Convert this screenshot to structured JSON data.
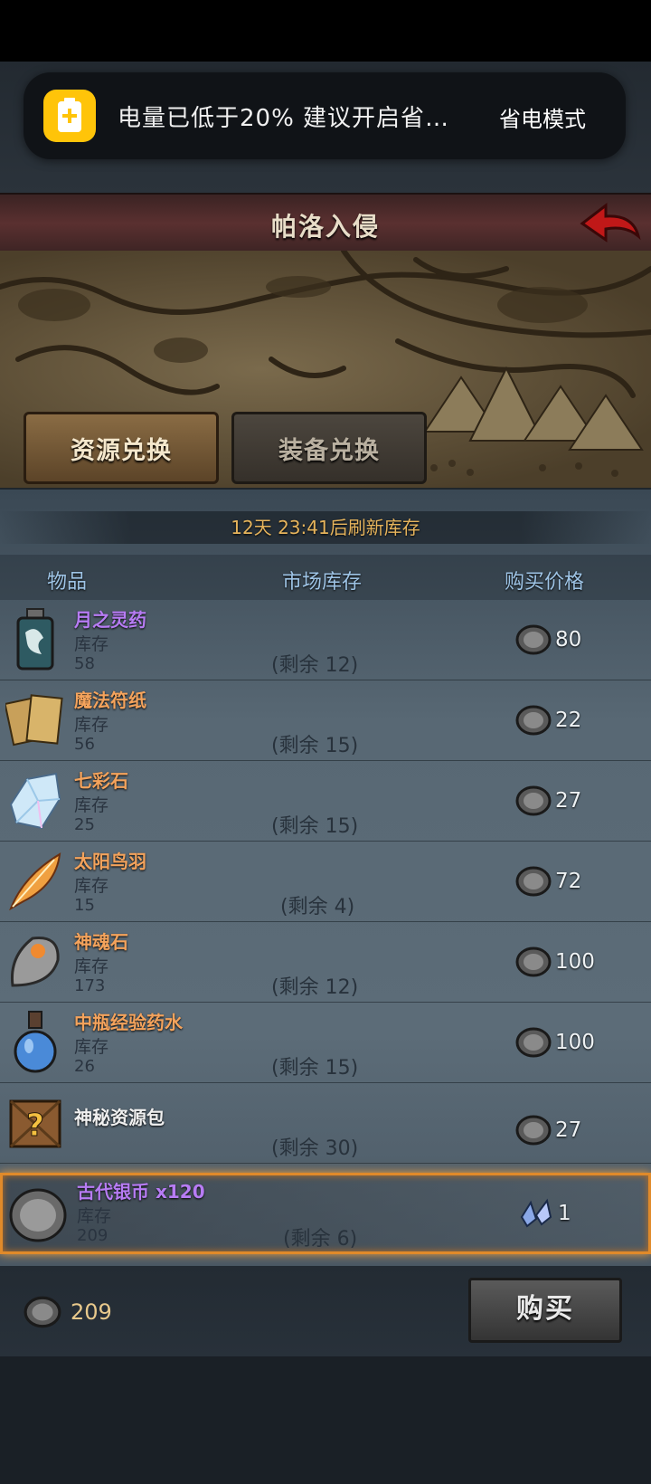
{
  "notification": {
    "icon": "battery-saver-icon",
    "message": "电量已低于20%  建议开启省…",
    "action": "省电模式",
    "accent": "#ffc409"
  },
  "header": {
    "title": "帕洛入侵",
    "back_icon": "red-arrow-back-icon"
  },
  "tabs": [
    {
      "label": "资源兑换",
      "active": true
    },
    {
      "label": "装备兑换",
      "active": false
    }
  ],
  "shop": {
    "refresh_text": "12天 23:41后刷新库存",
    "columns": [
      "物品",
      "市场库存",
      "购买价格"
    ],
    "items": [
      {
        "name": "月之灵药",
        "color": "#b77cf4",
        "stock_label": "库存",
        "stock": "58",
        "remaining": "(剩余 12)",
        "price": "80",
        "currency": "silver-coin-icon",
        "icon": "potion-bottle-icon"
      },
      {
        "name": "魔法符纸",
        "color": "#f4a35c",
        "stock_label": "库存",
        "stock": "56",
        "remaining": "(剩余 15)",
        "price": "22",
        "currency": "silver-coin-icon",
        "icon": "paper-scroll-icon"
      },
      {
        "name": "七彩石",
        "color": "#f4a35c",
        "stock_label": "库存",
        "stock": "25",
        "remaining": "(剩余 15)",
        "price": "27",
        "currency": "silver-coin-icon",
        "icon": "crystal-icon"
      },
      {
        "name": "太阳鸟羽",
        "color": "#f4a35c",
        "stock_label": "库存",
        "stock": "15",
        "remaining": "(剩余 4)",
        "price": "72",
        "currency": "silver-coin-icon",
        "icon": "feather-icon"
      },
      {
        "name": "神魂石",
        "color": "#f4a35c",
        "stock_label": "库存",
        "stock": "173",
        "remaining": "(剩余 12)",
        "price": "100",
        "currency": "silver-coin-icon",
        "icon": "soul-stone-icon"
      },
      {
        "name": "中瓶经验药水",
        "color": "#f4a35c",
        "stock_label": "库存",
        "stock": "26",
        "remaining": "(剩余 15)",
        "price": "100",
        "currency": "silver-coin-icon",
        "icon": "blue-potion-icon"
      },
      {
        "name": "神秘资源包",
        "color": "#f0f0f0",
        "stock_label": "",
        "stock": "",
        "remaining": "(剩余 30)",
        "price": "27",
        "currency": "silver-coin-icon",
        "icon": "mystery-crate-icon"
      },
      {
        "name": "古代银币 x120",
        "color": "#b77cf4",
        "stock_label": "库存",
        "stock": "209",
        "remaining": "(剩余 6)",
        "price": "1",
        "currency": "blue-crystal-icon",
        "icon": "ancient-silver-coin-icon",
        "selected": true
      }
    ]
  },
  "footer": {
    "balance": "209",
    "balance_icon": "silver-coin-icon",
    "buy_label": "购买"
  }
}
